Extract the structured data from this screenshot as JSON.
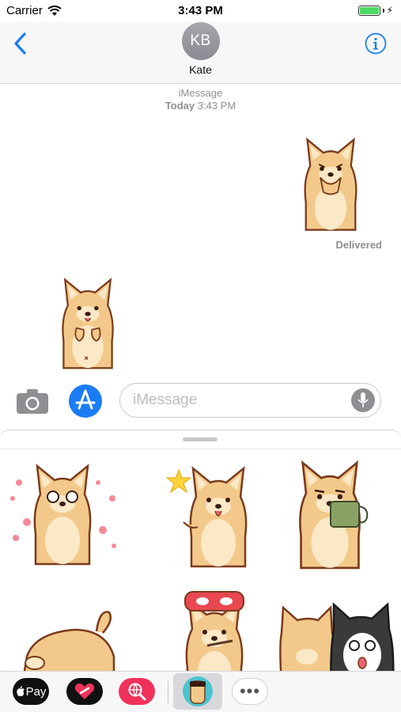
{
  "status_bar": {
    "carrier": "Carrier",
    "time": "3:43 PM",
    "battery_level": 1.0
  },
  "nav": {
    "avatar_initials": "KB",
    "contact_name": "Kate"
  },
  "thread": {
    "service": "iMessage",
    "date_label": "Today",
    "time_label": "3:43 PM",
    "delivered_label": "Delivered"
  },
  "compose": {
    "placeholder": "iMessage"
  },
  "app_strip": {
    "applepay_label": "Pay",
    "more_label": "•••"
  },
  "colors": {
    "ios_blue": "#1a7cf5",
    "shiba_fur": "#f3c98b",
    "shiba_belly": "#fbe8c6",
    "shiba_outline": "#7a3b1c",
    "search_app": "#f0325a",
    "battery": "#4cd964"
  },
  "icons": [
    "wifi-icon",
    "battery-icon",
    "back-chevron-icon",
    "info-icon",
    "camera-icon",
    "app-store-icon",
    "microphone-icon",
    "apple-logo-icon",
    "heart-icon",
    "globe-search-icon",
    "more-icon"
  ]
}
